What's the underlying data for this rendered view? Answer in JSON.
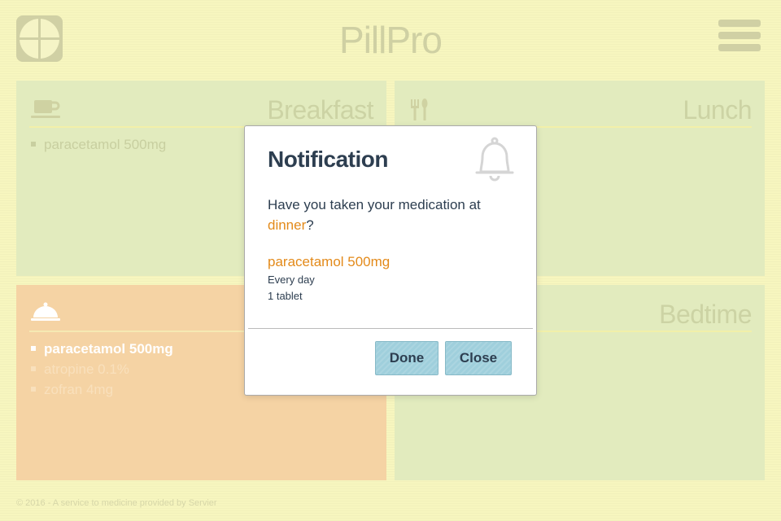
{
  "header": {
    "title": "PillPro",
    "logo_icon": "clock-icon",
    "menu_icon": "hamburger-menu-icon"
  },
  "panels": {
    "breakfast": {
      "title": "Breakfast",
      "icon": "coffee-cup-icon",
      "items": [
        "paracetamol 500mg"
      ]
    },
    "lunch": {
      "title": "Lunch",
      "icon": "fork-knife-icon",
      "items": []
    },
    "dinner": {
      "title": "",
      "icon": "cloche-icon",
      "items": [
        "paracetamol 500mg",
        "atropine 0.1%",
        "zofran 4mg"
      ]
    },
    "bedtime": {
      "title": "Bedtime",
      "icon": "",
      "items": []
    }
  },
  "footer": {
    "text": "© 2016 - A service to medicine provided by Servier"
  },
  "notification": {
    "title": "Notification",
    "icon": "bell-icon",
    "question_prefix": "Have you taken your medication at ",
    "meal": "dinner",
    "question_suffix": "?",
    "medication": {
      "name": "paracetamol 500mg",
      "frequency": "Every day",
      "dose": "1 tablet"
    },
    "buttons": {
      "done": "Done",
      "close": "Close"
    }
  },
  "colors": {
    "background": "#f7f6bf",
    "panel": "#e2ebbe",
    "active_panel": "#f5d3a4",
    "accent": "#e38a1a",
    "button": "#9fcfdc",
    "text_dark": "#2d3e50"
  }
}
